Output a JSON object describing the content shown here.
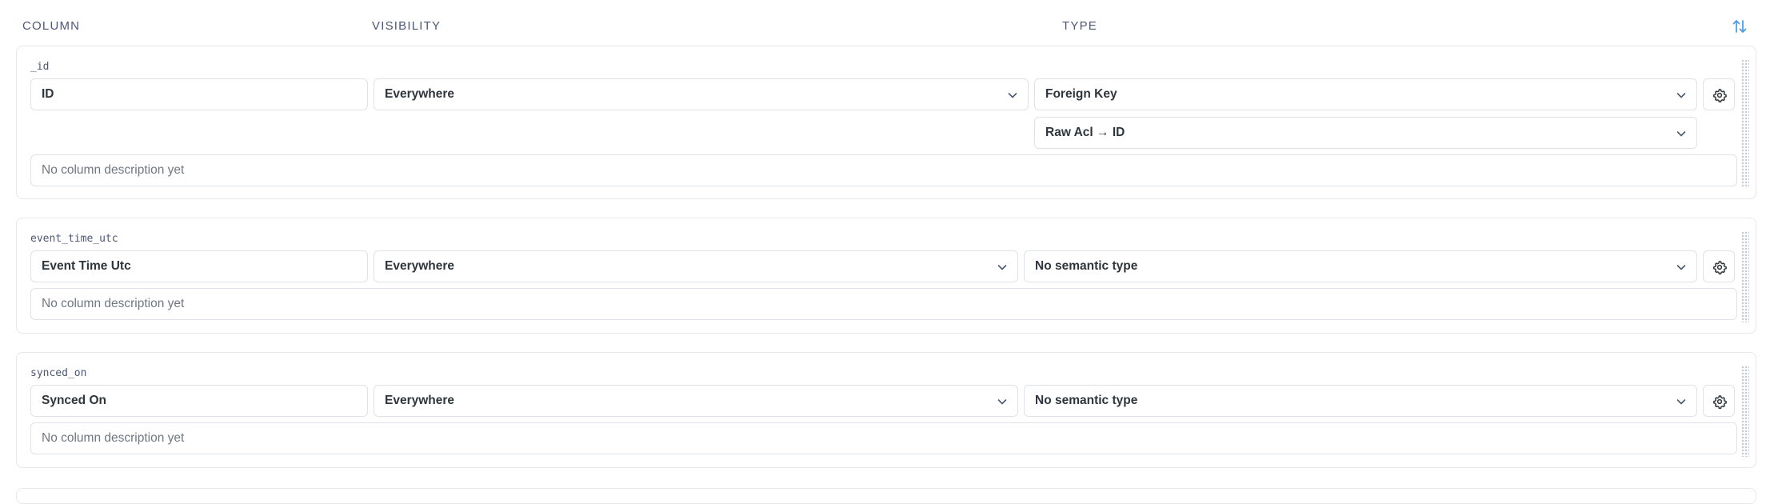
{
  "header": {
    "column": "COLUMN",
    "visibility": "VISIBILITY",
    "type": "TYPE",
    "sort_icon": "sort-arrows-icon",
    "accent": "#509ee3"
  },
  "columns": [
    {
      "name": "_id",
      "display_name": "ID",
      "visibility": "Everywhere",
      "type": "Foreign Key",
      "target": "Raw Acl → ID",
      "description_placeholder": "No column description yet"
    },
    {
      "name": "event_time_utc",
      "display_name": "Event Time Utc",
      "visibility": "Everywhere",
      "type": "No semantic type",
      "description_placeholder": "No column description yet"
    },
    {
      "name": "synced_on",
      "display_name": "Synced On",
      "visibility": "Everywhere",
      "type": "No semantic type",
      "description_placeholder": "No column description yet"
    }
  ]
}
